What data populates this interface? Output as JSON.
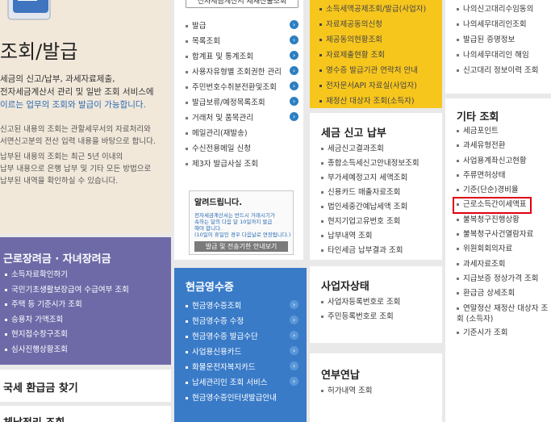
{
  "intro": {
    "title": "조회/발급",
    "desc_lines": [
      "세금의 신고/납부, 과세자료제출,",
      "전자세금계산서 관리 및 일반 조회 서비스에",
      "이르는 업무의 조회와 발급이 가능합니다."
    ],
    "notes": [
      "신고된 내용의 조회는 관할세무서의 자료처리와",
      "서면신고분의 전산 입력 내용을 바탕으로 합니다.",
      "납부된 내용의 조회는 최근 5년 이내의",
      "납부 내용으로 은행 납부 및 기타 모든 방법으로",
      "납부된 내역을 확인하실 수 있습니다."
    ]
  },
  "col2_top_button": "전자세금계산서 제재산출조회",
  "col2_items": [
    "발급",
    "목록조회",
    "합계표 및 통계조회",
    "사용자유형별 조회권한 관리",
    "주민번호수취분전환및조회",
    "발급보류/예정목록조회",
    "거래처 및 품목관리",
    "메일관리(재발송)",
    "수신전용메일 신청",
    "제3자 발급사실 조회"
  ],
  "notice": {
    "title": "알려드립니다.",
    "lines": [
      "전자세금계산서는 반드시 거래시기가",
      "속하는 달의 다음 달 10일까지 발급",
      "해야 합니다.",
      "(10일이 휴일인 경우 다음날로 연장됩니다.)"
    ],
    "button": "발급 및 전송기한 안내보기"
  },
  "yellow_box": {
    "items": [
      "소득세액공제조회/발급(사업자)",
      "자료제공동의신청",
      "제공동의현황조회",
      "자료제출현황 조회",
      "영수증 발급기관 연락처 안내",
      "전자문서API 자료실(사업자)",
      "재정산 대상자 조회(소득자)"
    ]
  },
  "tax_report": {
    "title": "세금 신고 납부",
    "items": [
      "세금신고결과조회",
      "종합소득세신고안내정보조회",
      "부가세예정고지 세액조회",
      "신용카드 매출자료조회",
      "법인세중간예납세액 조회",
      "현지기업고유번호 조회",
      "납부내역 조회",
      "타인세금 납부결과 조회"
    ]
  },
  "business_status": {
    "title": "사업자상태",
    "items": [
      "사업자등록번호로 조회",
      "주민등록번호로 조회"
    ]
  },
  "annual_pension": {
    "title": "연부연납",
    "items": [
      "허가내역 조회"
    ]
  },
  "col4_top": [
    "나의신고대리수임동의",
    "나의세무대리인조회",
    "발급된 증명정보",
    "나의세무대리인 해임",
    "신고대리 정보이력 조회"
  ],
  "etc": {
    "title": "기타 조회",
    "items": [
      "세금포인트",
      "과세유형전환",
      "사업용계좌신고현황",
      "주류면허상태",
      "기준(단순)경비율",
      "근로소득간이세액표",
      "불복청구진행상황",
      "불복청구사건열람자료",
      "위원회회의자료",
      "과세자료조회",
      "지급보증 정상가격 조회",
      "환급금 상세조회",
      "연말정산 재정산 대상자 조회 (소득자)",
      "기준시가 조회"
    ],
    "highlight_color": "#e0000f"
  },
  "earned_income": {
    "title": "근로장려금 · 자녀장려금",
    "items": [
      "소득자료확인하기",
      "국민기초생활보장급여 수급여부 조회",
      "주택 등 기준시가 조회",
      "승용차 가액조회",
      "현지접수창구조회",
      "심사진행상황조회"
    ]
  },
  "cash_receipt": {
    "title": "현금영수증",
    "items": [
      "현금영수증조회",
      "현금영수증 수정",
      "현금영수증 발급수단",
      "사업용신용카드",
      "화물운전자복지카드",
      "납세관리인 조회 서비스",
      "현금영수증인터넷발급안내"
    ]
  },
  "refund": {
    "title": "국세 환급금 찾기"
  },
  "delinquent": {
    "title": "체납정리 조회"
  },
  "colors": {
    "purple": "#6e6aa8",
    "blue": "#3a7bc8",
    "yellow": "#f7c61d",
    "accent_blue": "#2a6ab4"
  }
}
